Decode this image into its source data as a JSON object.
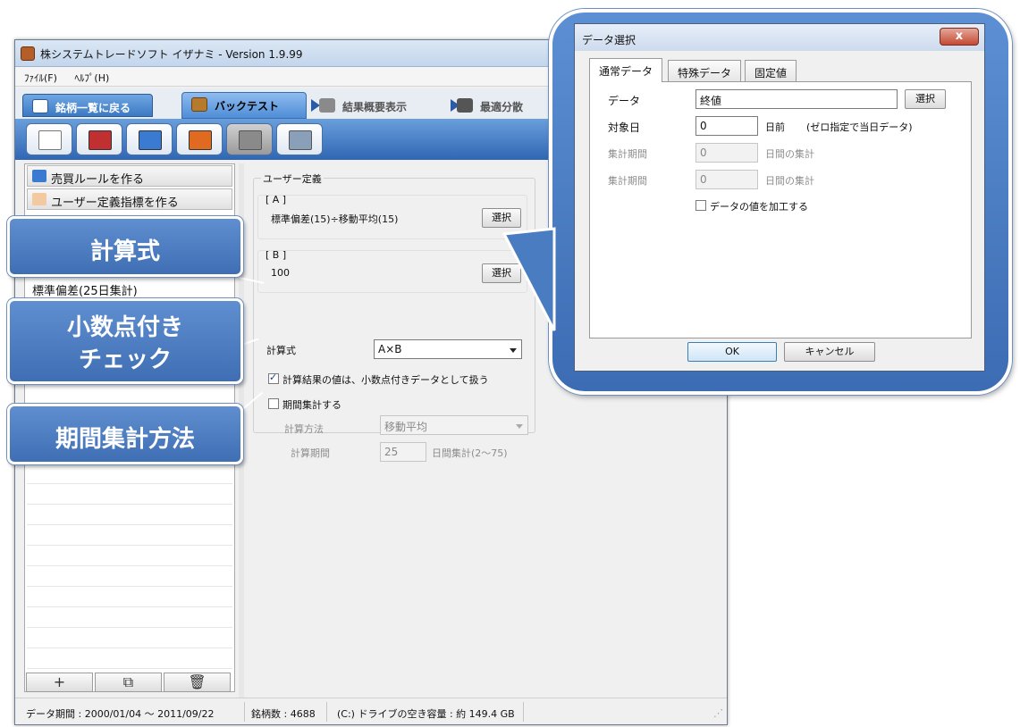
{
  "window": {
    "title": "株システムトレードソフト イザナミ - Version 1.9.99"
  },
  "menu": [
    "ﾌｧｲﾙ(F)",
    "ﾍﾙﾌﾟ(H)"
  ],
  "tabs": [
    {
      "label": "銘柄一覧に戻る"
    },
    {
      "label": "バックテスト"
    },
    {
      "label": "結果概要表示"
    },
    {
      "label": "最適分散"
    }
  ],
  "left_panel": {
    "buttons": [
      "売買ルールを作る",
      "ユーザー定義指標を作る"
    ],
    "list_items": [
      "標準偏差(25日集計)"
    ],
    "bottom_buttons": [
      "+",
      "⧉",
      "🗑"
    ]
  },
  "user_def": {
    "group_title": "ユーザー定義",
    "a_label": "[ A ]",
    "a_value": "標準偏差(15)÷移動平均(15)",
    "b_label": "[ B ]",
    "b_value": "100",
    "select_btn": "選択",
    "formula_label": "計算式",
    "formula_value": "A×B",
    "decimal_check_label": "計算結果の値は、小数点付きデータとして扱う",
    "period_check_label": "期間集計する",
    "calc_method_label": "計算方法",
    "calc_method_value": "移動平均",
    "calc_period_label": "計算期間",
    "calc_period_value": "25",
    "calc_period_suffix": "日間集計(2〜75)"
  },
  "status": {
    "data_period": "データ期間 : 2000/01/04 〜 2011/09/22",
    "stock_count": "銘柄数 : 4688",
    "disk_free": "(C:) ドライブの空き容量 : 約 149.4 GB"
  },
  "callouts": {
    "formula": "計算式",
    "decimal": "小数点付き\nチェック",
    "decimal_l1": "小数点付き",
    "decimal_l2": "チェック",
    "period_method": "期間集計方法"
  },
  "dialog": {
    "title": "データ選択",
    "close": "x",
    "tabs": [
      "通常データ",
      "特殊データ",
      "固定値"
    ],
    "data_label": "データ",
    "data_value": "終値",
    "select_btn": "選択",
    "target_day_label": "対象日",
    "target_day_value": "0",
    "target_day_suffix": "日前",
    "target_day_note": "(ゼロ指定で当日データ)",
    "agg_period_label_1": "集計期間",
    "agg_period_value_1": "0",
    "agg_period_suffix_1": "日間の集計",
    "agg_period_label_2": "集計期間",
    "agg_period_value_2": "0",
    "agg_period_suffix_2": "日間の集計",
    "process_check_label": "データの値を加工する",
    "ok": "OK",
    "cancel": "キャンセル"
  }
}
